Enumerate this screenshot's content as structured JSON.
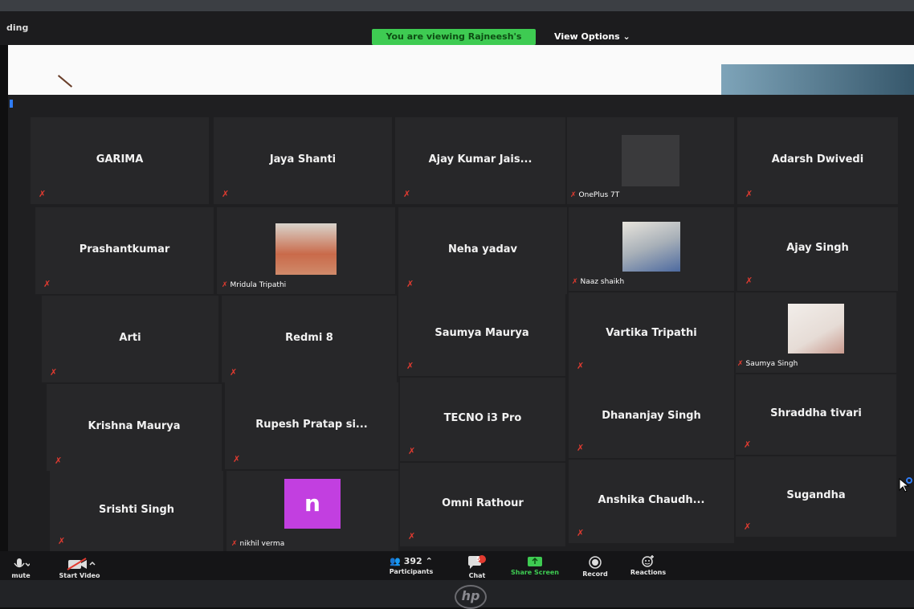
{
  "top_bar": {
    "recording_text": "ding",
    "viewing_banner": "You are viewing Rajneesh's screen",
    "view_options": "View Options ⌄"
  },
  "participants": [
    {
      "name": "GARIMA"
    },
    {
      "name": "Jaya Shanti"
    },
    {
      "name": "Ajay Kumar Jais..."
    },
    {
      "name": "",
      "tag": "OnePlus 7T"
    },
    {
      "name": "Adarsh Dwivedi"
    },
    {
      "name": "Prashantkumar"
    },
    {
      "name": "",
      "tag": "Mridula Tripathi"
    },
    {
      "name": "Neha yadav"
    },
    {
      "name": "",
      "tag": "Naaz shaikh"
    },
    {
      "name": "Ajay Singh"
    },
    {
      "name": "Arti"
    },
    {
      "name": "Redmi 8"
    },
    {
      "name": "Saumya Maurya"
    },
    {
      "name": "Vartika Tripathi"
    },
    {
      "name": "",
      "tag": "Saumya Singh"
    },
    {
      "name": "Krishna Maurya"
    },
    {
      "name": "Rupesh Pratap si..."
    },
    {
      "name": "TECNO i3 Pro"
    },
    {
      "name": "Dhananjay Singh"
    },
    {
      "name": "Shraddha tivari"
    },
    {
      "name": "Srishti Singh"
    },
    {
      "name": "",
      "tag": "nikhil verma",
      "avatar_letter": "n"
    },
    {
      "name": "Omni Rathour"
    },
    {
      "name": "Anshika Chaudh..."
    },
    {
      "name": "Sugandha"
    }
  ],
  "toolbar": {
    "mute": "mute",
    "start_video": "Start Video",
    "participants_label": "Participants",
    "participants_count": "392",
    "chat": "Chat",
    "chat_badge": "5",
    "share_screen": "Share Screen",
    "record": "Record",
    "reactions": "Reactions"
  },
  "monitor": {
    "brand": "hp"
  },
  "colors": {
    "banner_green": "#3ecb52",
    "muted_red": "#e23b30",
    "share_green": "#3ecb52",
    "avatar_purple": "#c23fe0"
  }
}
